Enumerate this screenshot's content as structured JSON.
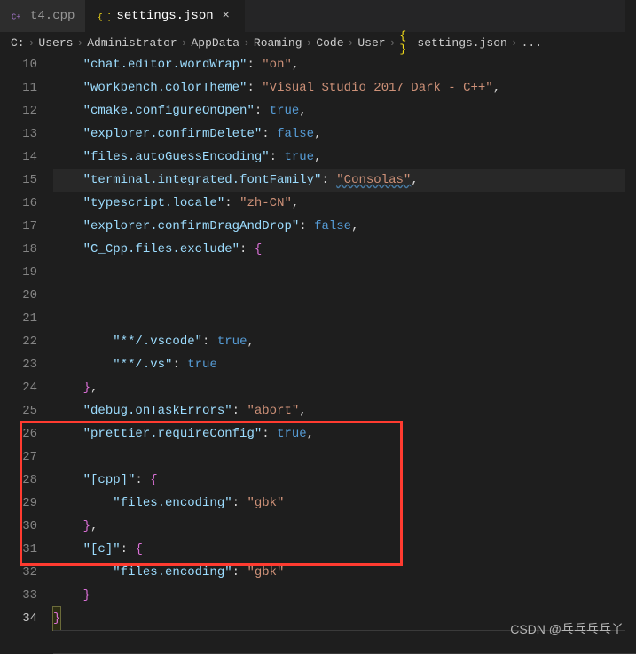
{
  "tabs": [
    {
      "icon": "cpp",
      "label": "t4.cpp",
      "active": false
    },
    {
      "icon": "json",
      "label": "settings.json",
      "active": true
    }
  ],
  "breadcrumbs": {
    "parts": [
      "C:",
      "Users",
      "Administrator",
      "AppData",
      "Roaming",
      "Code",
      "User"
    ],
    "file": "settings.json",
    "trail": "..."
  },
  "lines": {
    "start": 10,
    "count": 25,
    "active": 34
  },
  "code": {
    "l10_key": "\"chat.editor.wordWrap\"",
    "l10_val": "\"on\"",
    "l11_key": "\"workbench.colorTheme\"",
    "l11_val": "\"Visual Studio 2017 Dark - C++\"",
    "l12_key": "\"cmake.configureOnOpen\"",
    "l12_val": "true",
    "l13_key": "\"explorer.confirmDelete\"",
    "l13_val": "false",
    "l14_key": "\"files.autoGuessEncoding\"",
    "l14_val": "true",
    "l15_key": "\"terminal.integrated.fontFamily\"",
    "l15_val": "\"Consolas\"",
    "l16_key": "\"typescript.locale\"",
    "l16_val": "\"zh-CN\"",
    "l17_key": "\"explorer.confirmDragAndDrop\"",
    "l17_val": "false",
    "l18_key": "\"C_Cpp.files.exclude\"",
    "l22_key": "\"**/.vscode\"",
    "l22_val": "true",
    "l23_key": "\"**/.vs\"",
    "l23_val": "true",
    "l25_key": "\"debug.onTaskErrors\"",
    "l25_val": "\"abort\"",
    "l26_key": "\"prettier.requireConfig\"",
    "l26_val": "true",
    "l28_key": "\"[cpp]\"",
    "l29_key": "\"files.encoding\"",
    "l29_val": "\"gbk\"",
    "l31_key": "\"[c]\"",
    "l32_key": "\"files.encoding\"",
    "l32_val": "\"gbk\""
  },
  "watermark": "CSDN @乓乓乓乓丫"
}
